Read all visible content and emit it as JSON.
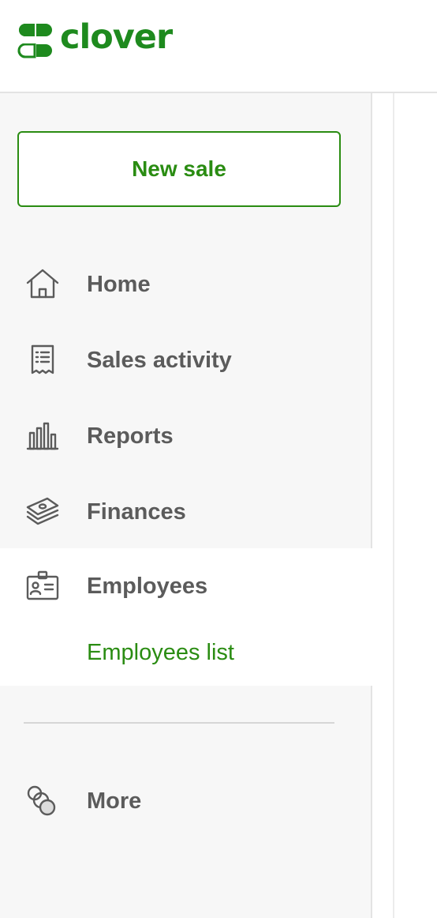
{
  "brand": {
    "name": "clover",
    "color": "#1e8a1e"
  },
  "sidebar": {
    "new_sale_label": "New sale",
    "items": [
      {
        "label": "Home",
        "icon": "home-icon"
      },
      {
        "label": "Sales activity",
        "icon": "receipt-icon"
      },
      {
        "label": "Reports",
        "icon": "bar-chart-icon"
      },
      {
        "label": "Finances",
        "icon": "money-stack-icon"
      },
      {
        "label": "Employees",
        "icon": "id-badge-icon",
        "active": true,
        "subitems": [
          {
            "label": "Employees list",
            "active": true
          }
        ]
      },
      {
        "label": "More",
        "icon": "circles-icon"
      }
    ]
  },
  "colors": {
    "accent": "#2a8c12",
    "text": "#5b5b5b",
    "sidebar_bg": "#f7f7f7"
  }
}
